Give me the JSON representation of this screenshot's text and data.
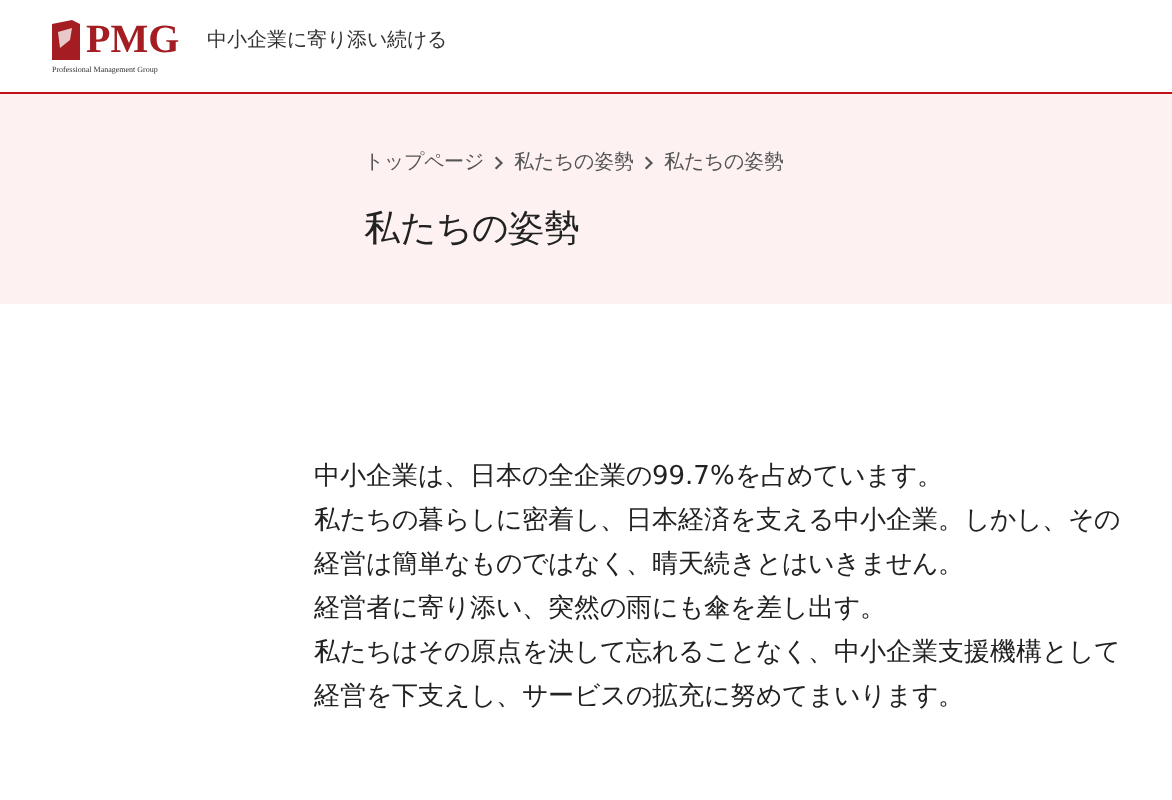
{
  "header": {
    "logo": "PMG",
    "logo_subtitle": "Professional Management Group",
    "tagline": "中小企業に寄り添い続ける"
  },
  "breadcrumb": [
    "トップページ",
    "私たちの姿勢",
    "私たちの姿勢"
  ],
  "page_title": "私たちの姿勢",
  "body_lines": [
    "中小企業は、日本の全企業の99.7%を占めています。",
    "私たちの暮らしに密着し、日本経済を支える中小企業。しかし、その",
    "経営は簡単なものではなく、晴天続きとはいきません。",
    "経営者に寄り添い、突然の雨にも傘を差し出す。",
    "私たちはその原点を決して忘れることなく、中小企業支援機構として",
    "経営を下支えし、サービスの拡充に努めてまいります。"
  ]
}
